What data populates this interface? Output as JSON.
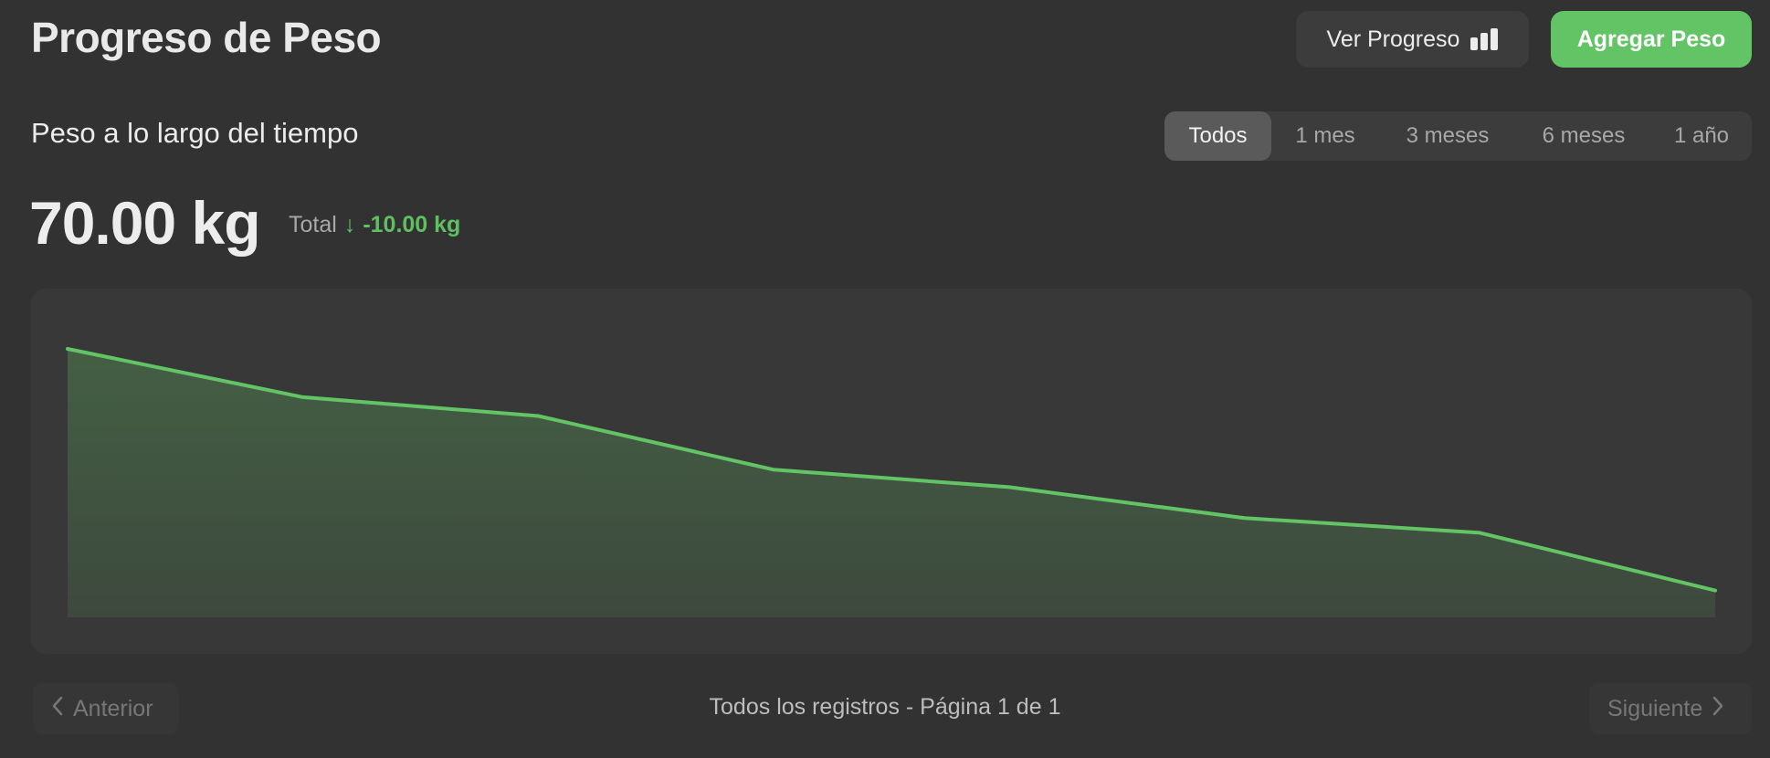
{
  "header": {
    "title": "Progreso de Peso",
    "view_progress_label": "Ver Progreso",
    "view_progress_icon": "bar-chart-icon",
    "add_weight_label": "Agregar Peso",
    "accent_color": "#63c466"
  },
  "section": {
    "title": "Peso a lo largo del tiempo",
    "ranges": [
      "Todos",
      "1 mes",
      "3 meses",
      "6 meses",
      "1 año"
    ],
    "selected_range": "Todos"
  },
  "summary": {
    "current_weight": "70.00 kg",
    "total_label": "Total",
    "total_change": "-10.00 kg",
    "change_color": "#5fc061"
  },
  "chart_data": {
    "type": "area",
    "x": [
      1,
      2,
      3,
      4,
      5,
      6,
      7,
      8
    ],
    "values": [
      80.0,
      78.2,
      77.5,
      75.5,
      74.85,
      73.7,
      73.15,
      71.0
    ],
    "ylim": [
      70.0,
      80.0
    ],
    "line_color": "#62c464",
    "grid": false,
    "title": "",
    "xlabel": "",
    "ylabel": ""
  },
  "pagination": {
    "prev_label": "Anterior",
    "next_label": "Siguiente",
    "info": "Todos los registros - Página 1 de 1"
  }
}
